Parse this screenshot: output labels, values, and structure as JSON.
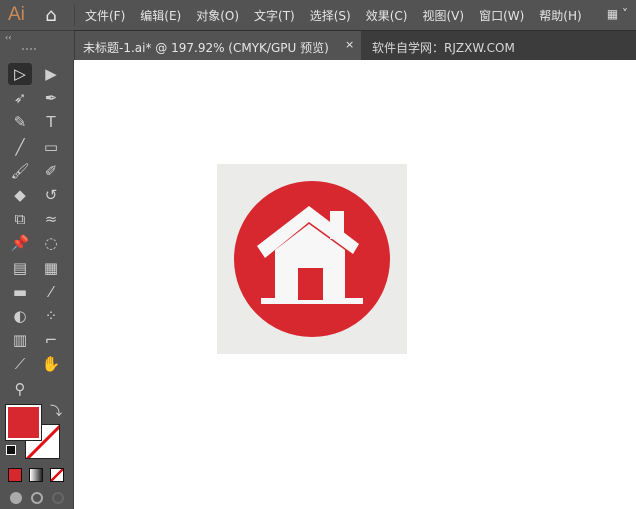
{
  "app": {
    "logo": "Ai",
    "home_icon": "home-icon"
  },
  "menus": [
    "文件(F)",
    "编辑(E)",
    "对象(O)",
    "文字(T)",
    "选择(S)",
    "效果(C)",
    "视图(V)",
    "窗口(W)",
    "帮助(H)"
  ],
  "workspace_icon": "▦ ˅",
  "tabs": {
    "active": "未标题-1.ai* @ 197.92% (CMYK/GPU 预览)",
    "close": "×",
    "secondary": "软件自学网：RJZXW.COM"
  },
  "panel": {
    "collapse": "‹‹"
  },
  "tools": [
    {
      "name": "selection-tool",
      "glyph": "▷"
    },
    {
      "name": "direct-selection-tool",
      "glyph": "▶"
    },
    {
      "name": "magic-wand-tool",
      "glyph": "➶"
    },
    {
      "name": "pen-tool",
      "glyph": "✒"
    },
    {
      "name": "curvature-tool",
      "glyph": "✎"
    },
    {
      "name": "type-tool",
      "glyph": "T"
    },
    {
      "name": "line-tool",
      "glyph": "╱"
    },
    {
      "name": "rectangle-tool",
      "glyph": "▭"
    },
    {
      "name": "paintbrush-tool",
      "glyph": "🖌"
    },
    {
      "name": "shaper-tool",
      "glyph": "✐"
    },
    {
      "name": "eraser-tool",
      "glyph": "◆"
    },
    {
      "name": "rotate-tool",
      "glyph": "↺"
    },
    {
      "name": "scale-tool",
      "glyph": "⧉"
    },
    {
      "name": "warp-tool",
      "glyph": "≈"
    },
    {
      "name": "puppet-warp-tool",
      "glyph": "📌"
    },
    {
      "name": "free-transform-tool",
      "glyph": "◌"
    },
    {
      "name": "perspective-grid-tool",
      "glyph": "▤"
    },
    {
      "name": "mesh-tool",
      "glyph": "▦"
    },
    {
      "name": "gradient-tool",
      "glyph": "▬"
    },
    {
      "name": "eyedropper-tool",
      "glyph": "⁄"
    },
    {
      "name": "blend-tool",
      "glyph": "◐"
    },
    {
      "name": "symbol-sprayer-tool",
      "glyph": "⁘"
    },
    {
      "name": "column-graph-tool",
      "glyph": "▥"
    },
    {
      "name": "artboard-tool",
      "glyph": "⌐"
    },
    {
      "name": "slice-tool",
      "glyph": "⟋"
    },
    {
      "name": "hand-tool",
      "glyph": "✋"
    },
    {
      "name": "zoom-tool",
      "glyph": "⚲"
    }
  ],
  "colors": {
    "fill": "#d8282f",
    "stroke": "none",
    "accent": "#d8282f",
    "artboard": "#ebebe9"
  }
}
